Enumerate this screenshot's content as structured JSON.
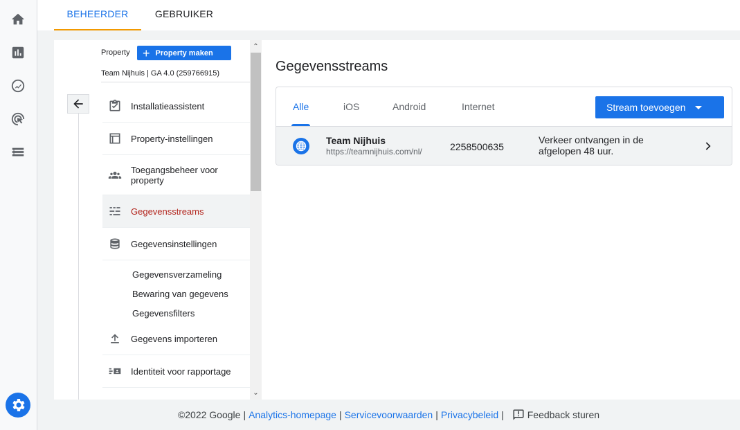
{
  "rail": {
    "icons": [
      "home-icon",
      "reports-icon",
      "explore-icon",
      "advertising-icon",
      "configure-icon"
    ],
    "settings_icon": "gear-icon"
  },
  "topbar": {
    "tabs": [
      "BEHEERDER",
      "GEBRUIKER"
    ],
    "active_tab": "BEHEERDER"
  },
  "property": {
    "label": "Property",
    "create_button": "Property maken",
    "name": "Team Nijhuis | GA 4.0 (259766915)"
  },
  "nav": {
    "items": [
      {
        "label": "Installatieassistent",
        "icon": "checklist-icon"
      },
      {
        "label": "Property-instellingen",
        "icon": "layout-icon"
      },
      {
        "label": "Toegangsbeheer voor property",
        "icon": "people-icon"
      },
      {
        "label": "Gegevensstreams",
        "icon": "streams-icon",
        "active": true
      },
      {
        "label": "Gegevensinstellingen",
        "icon": "database-icon"
      }
    ],
    "sub_items": [
      "Gegevensverzameling",
      "Bewaring van gegevens",
      "Gegevensfilters"
    ],
    "items_after": [
      {
        "label": "Gegevens importeren",
        "icon": "upload-icon"
      },
      {
        "label": "Identiteit voor rapportage",
        "icon": "identity-icon"
      }
    ]
  },
  "main": {
    "title": "Gegevensstreams",
    "filter_tabs": [
      "Alle",
      "iOS",
      "Android",
      "Internet"
    ],
    "active_filter": "Alle",
    "add_stream_button": "Stream toevoegen",
    "streams": [
      {
        "name": "Team Nijhuis",
        "url": "https://teamnijhuis.com/nl/",
        "id": "2258500635",
        "status": "Verkeer ontvangen in de afgelopen 48 uur.",
        "icon": "globe-icon"
      }
    ]
  },
  "footer": {
    "copyright": "©2022 Google",
    "links": [
      "Analytics-homepage",
      "Servicevoorwaarden",
      "Privacybeleid"
    ],
    "separator": "|",
    "feedback": "Feedback sturen"
  },
  "colors": {
    "accent": "#1a73e8",
    "active_nav_text": "#b3261e",
    "tab_underline": "#f29900"
  }
}
